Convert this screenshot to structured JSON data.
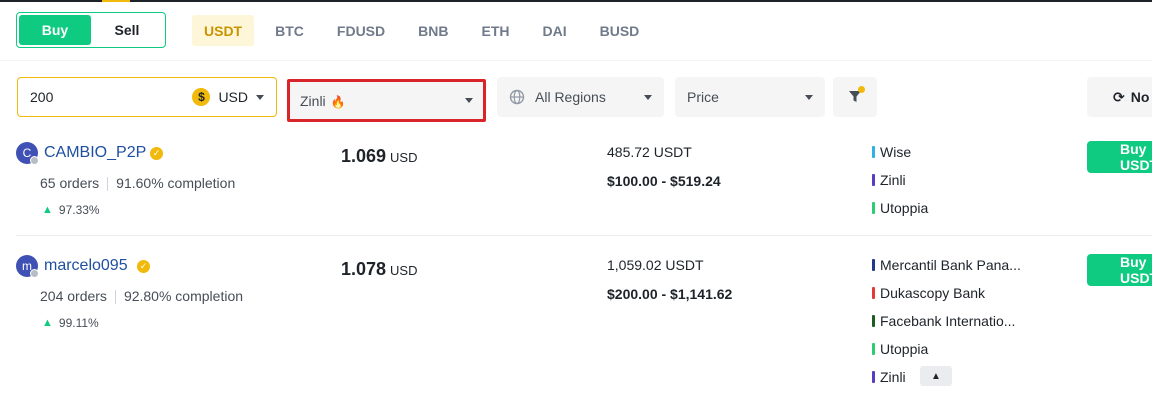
{
  "toggle": {
    "buy": "Buy",
    "sell": "Sell"
  },
  "assets": [
    "USDT",
    "BTC",
    "FDUSD",
    "BNB",
    "ETH",
    "DAI",
    "BUSD"
  ],
  "filters": {
    "amount": "200",
    "currency_symbol": "$",
    "currency": "USD",
    "payment": "Zinli",
    "payment_badge": "🔥",
    "region": "All Regions",
    "sort": "Price",
    "refresh": "No"
  },
  "offers": [
    {
      "avatar_letter": "C",
      "name": "CAMBIO_P2P",
      "orders": "65 orders",
      "completion": "91.60% completion",
      "rating": "97.33%",
      "price": "1.069",
      "price_unit": "USD",
      "available": "485.72 USDT",
      "limit": "$100.00 - $519.24",
      "methods": [
        {
          "name": "Wise",
          "color": "#2bb1e6"
        },
        {
          "name": "Zinli",
          "color": "#5a3cc4"
        },
        {
          "name": "Utoppia",
          "color": "#2ecc71"
        }
      ],
      "action": "Buy USDT"
    },
    {
      "avatar_letter": "m",
      "name": "marcelo095",
      "orders": "204 orders",
      "completion": "92.80% completion",
      "rating": "99.11%",
      "price": "1.078",
      "price_unit": "USD",
      "available": "1,059.02 USDT",
      "limit": "$200.00 - $1,141.62",
      "methods": [
        {
          "name": "Mercantil Bank Pana...",
          "color": "#1f3a8a"
        },
        {
          "name": "Dukascopy Bank",
          "color": "#e53935"
        },
        {
          "name": "Facebank Internatio...",
          "color": "#1b5e20"
        },
        {
          "name": "Utoppia",
          "color": "#2ecc71"
        },
        {
          "name": "Zinli",
          "color": "#5a3cc4"
        }
      ],
      "action": "Buy USDT"
    }
  ],
  "colors": {
    "accent": "#f0b90b",
    "buy": "#0ecb81",
    "highlight": "#d9252a"
  }
}
